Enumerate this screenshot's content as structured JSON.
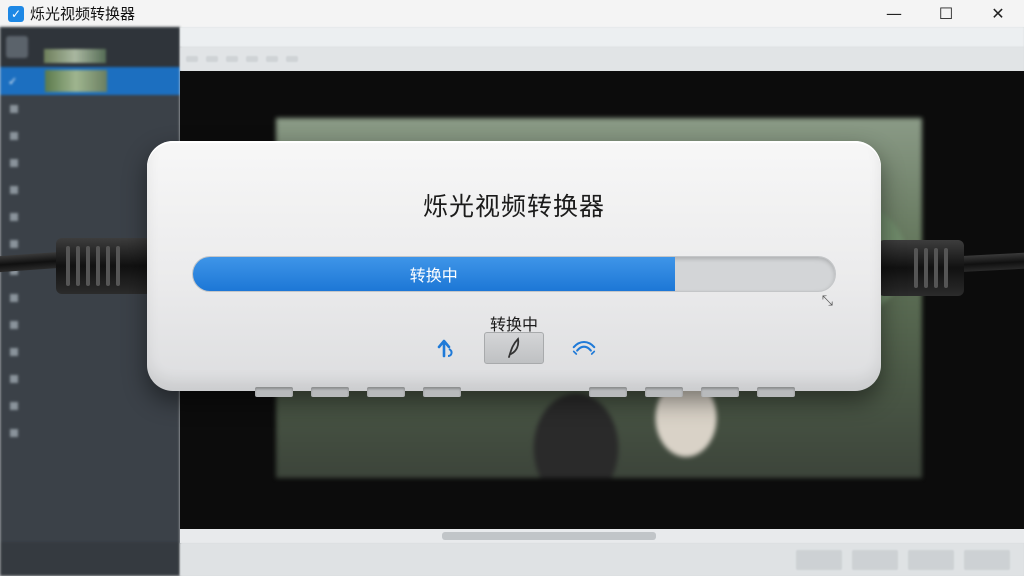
{
  "window": {
    "title": "烁光视频转换器",
    "controls": {
      "minimize": "—",
      "maximize": "☐",
      "close": "✕"
    }
  },
  "device": {
    "title": "烁光视频转换器",
    "progress": {
      "label": "转换中",
      "fraction": 0.75
    },
    "status_text": "转换中",
    "left_icon": "upload-arrow-icon",
    "center_icon": "feather-icon",
    "right_icon": "wifi-wave-icon",
    "accent_color": "#1f7ad8"
  }
}
